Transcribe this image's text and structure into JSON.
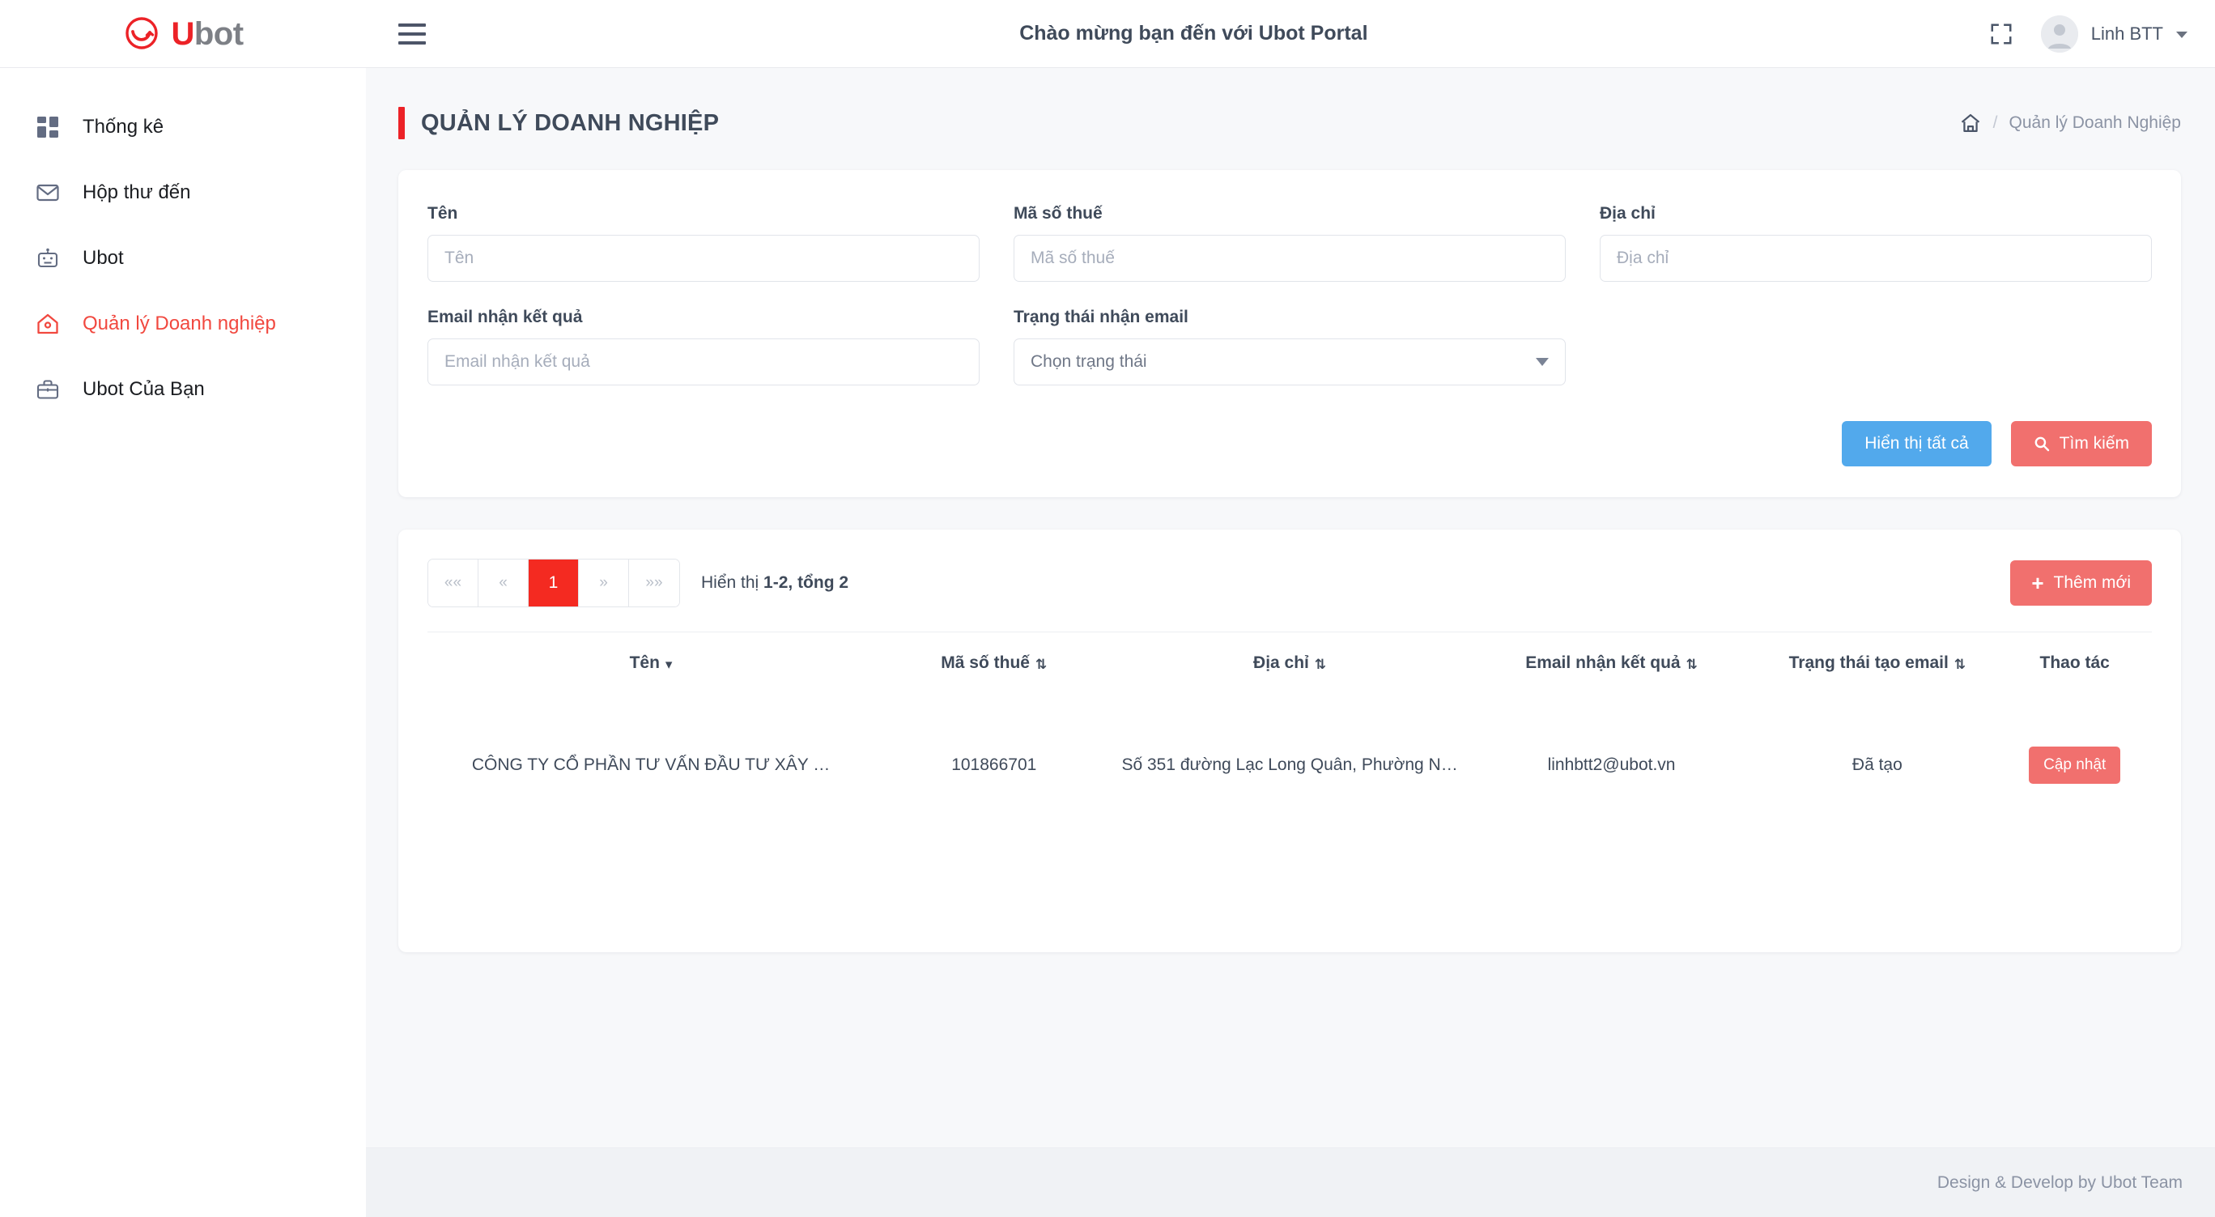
{
  "brand": {
    "name_first": "U",
    "name_rest": "bot"
  },
  "topbar": {
    "title": "Chào mừng bạn đến với Ubot Portal",
    "user_name": "Linh BTT"
  },
  "sidebar": {
    "items": [
      {
        "label": "Thống kê",
        "icon": "grid-icon",
        "active": false
      },
      {
        "label": "Hộp thư đến",
        "icon": "envelope-icon",
        "active": false
      },
      {
        "label": "Ubot",
        "icon": "robot-icon",
        "active": false
      },
      {
        "label": "Quản lý Doanh nghiệp",
        "icon": "home-outline-icon",
        "active": true
      },
      {
        "label": "Ubot Của Bạn",
        "icon": "briefcase-icon",
        "active": false
      }
    ]
  },
  "page": {
    "title": "QUẢN LÝ DOANH NGHIỆP",
    "breadcrumb_sep": "/",
    "breadcrumb_current": "Quản lý Doanh Nghiệp"
  },
  "search_form": {
    "fields": [
      {
        "label": "Tên",
        "placeholder": "Tên",
        "value": "",
        "type": "text"
      },
      {
        "label": "Mã số thuế",
        "placeholder": "Mã số thuế",
        "value": "",
        "type": "text"
      },
      {
        "label": "Địa chỉ",
        "placeholder": "Địa chỉ",
        "value": "",
        "type": "text"
      },
      {
        "label": "Email nhận kết quả",
        "placeholder": "Email nhận kết quả",
        "value": "",
        "type": "text"
      },
      {
        "label": "Trạng thái nhận email",
        "placeholder": "Chọn trạng thái",
        "value": "Chọn trạng thái",
        "type": "select"
      }
    ],
    "show_all_label": "Hiển thị tất cả",
    "search_label": "Tìm kiếm"
  },
  "table_panel": {
    "pagination": {
      "first": "««",
      "prev": "«",
      "current": "1",
      "next": "»",
      "last": "»»"
    },
    "info_prefix": "Hiển thị ",
    "info_strong": "1-2, tổng 2",
    "add_label": "Thêm mới",
    "columns": [
      {
        "label": "Tên",
        "sort": "desc"
      },
      {
        "label": "Mã số thuế",
        "sort": "both"
      },
      {
        "label": "Địa chỉ",
        "sort": "both"
      },
      {
        "label": "Email nhận kết quả",
        "sort": "both"
      },
      {
        "label": "Trạng thái tạo email",
        "sort": "both"
      },
      {
        "label": "Thao tác",
        "sort": "none"
      }
    ],
    "rows": [
      {
        "ten": "CÔNG TY CỔ PHẦN TƯ VẤN ĐẦU TƯ XÂY …",
        "ma_so_thue": "101866701",
        "dia_chi": "Số 351 đường Lạc Long Quân, Phường N…",
        "email": "linhbtt2@ubot.vn",
        "trang_thai": "Đã tạo",
        "action_label": "Cập nhật"
      }
    ]
  },
  "footer": {
    "text": "Design & Develop by Ubot Team"
  },
  "colors": {
    "brand_red": "#ec2227",
    "accent_red": "#f1706e",
    "page_red": "#f42a21",
    "blue": "#52a9ec",
    "text_dark": "#3f4a5a",
    "muted": "#8b93a4"
  }
}
